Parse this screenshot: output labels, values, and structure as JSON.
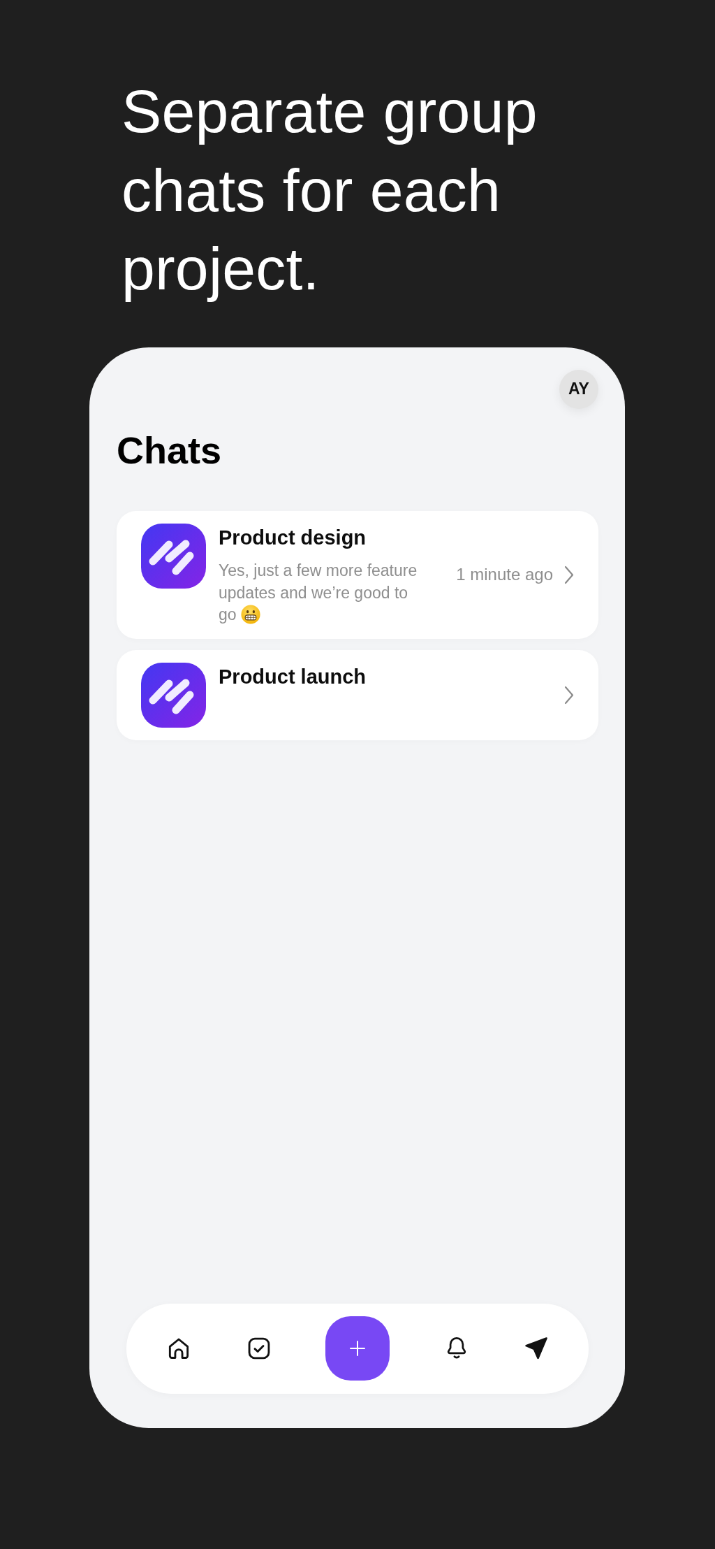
{
  "headline": "Separate group chats for each project.",
  "header": {
    "avatar": "AY",
    "title": "Chats"
  },
  "chats": [
    {
      "name": "Product design",
      "message": "Yes, just a few more feature updates and we’re good to go",
      "trailing_emoji": true,
      "time": "1 minute ago"
    },
    {
      "name": "Product launch"
    }
  ],
  "nav": [
    {
      "kind": "home"
    },
    {
      "kind": "tasks"
    },
    {
      "kind": "add"
    },
    {
      "kind": "alerts"
    },
    {
      "kind": "send"
    }
  ]
}
